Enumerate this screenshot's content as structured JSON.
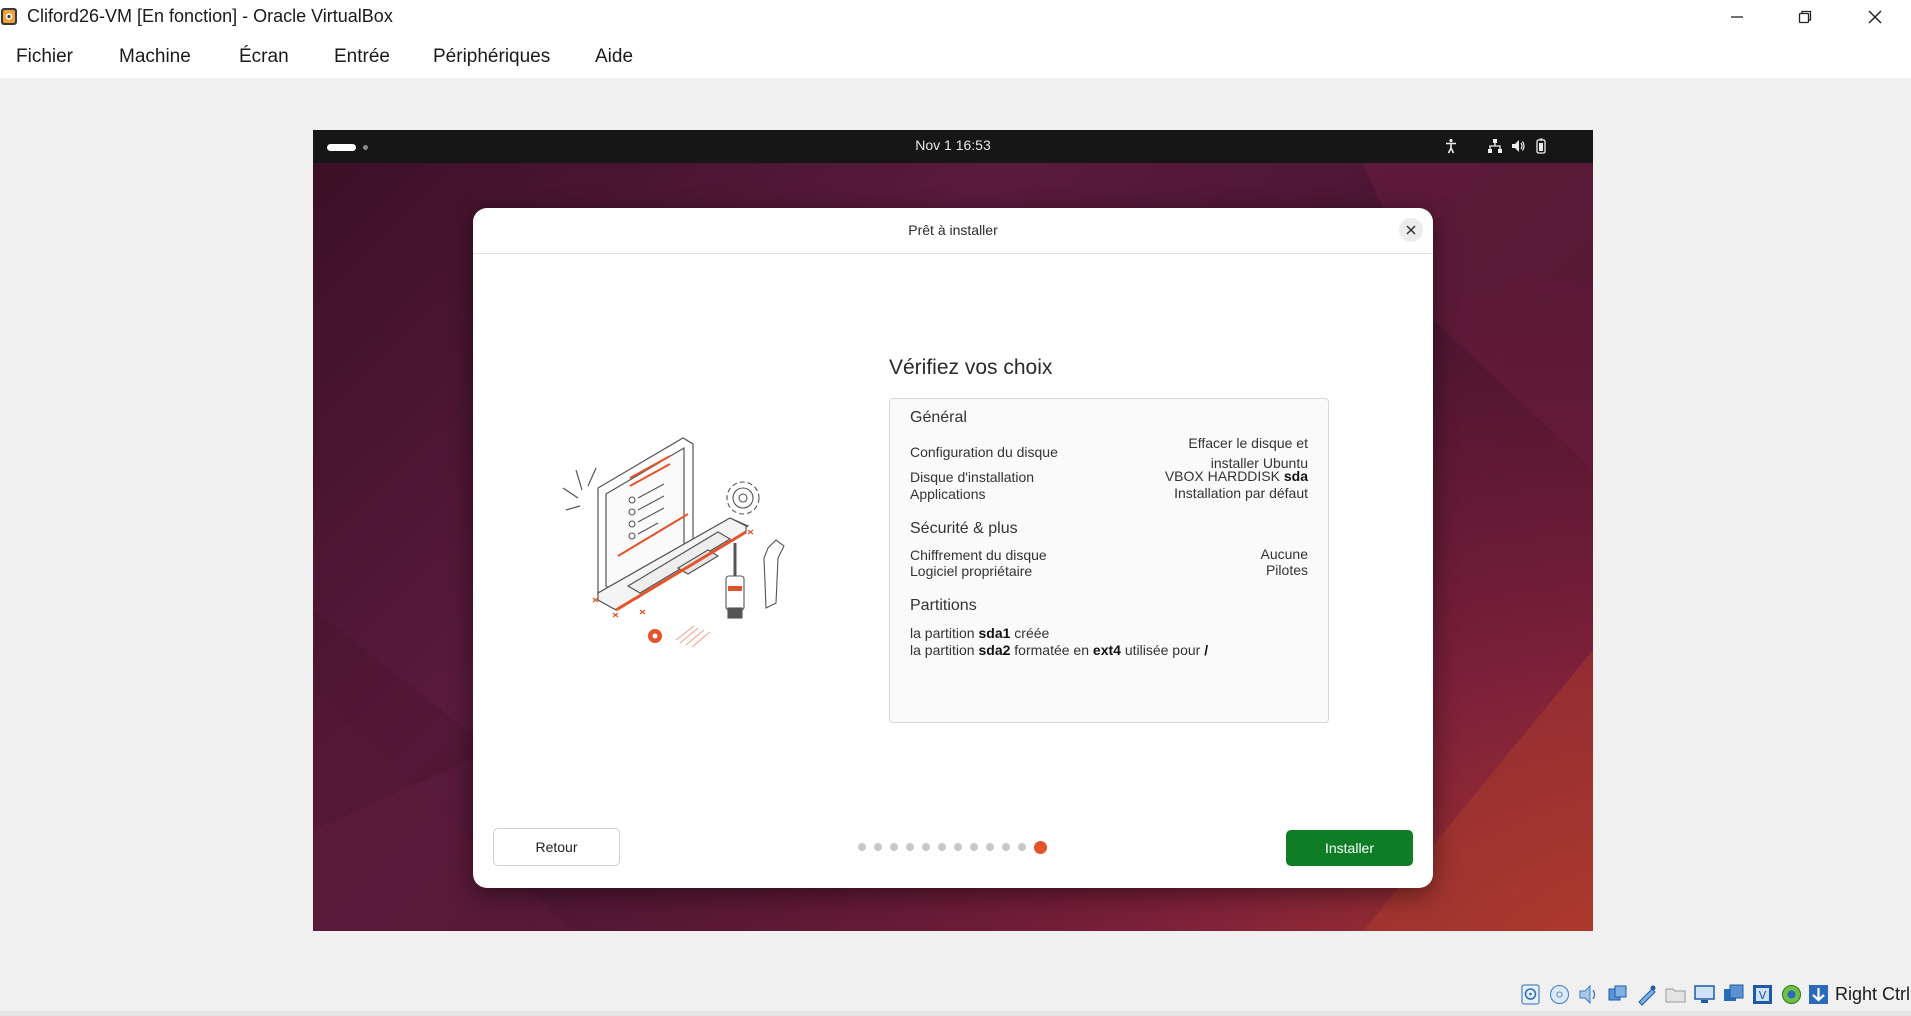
{
  "window": {
    "title": "Cliford26-VM [En fonction] - Oracle VirtualBox"
  },
  "menu": [
    "Fichier",
    "Machine",
    "Écran",
    "Entrée",
    "Périphériques",
    "Aide"
  ],
  "guest": {
    "topbar": {
      "clock": "Nov 1  16:53"
    },
    "dialog": {
      "title": "Prêt à installer",
      "heading": "Vérifiez vos choix",
      "general": {
        "title": "Général",
        "rows": [
          {
            "label": "Configuration du disque",
            "value_line1": "Effacer le disque et",
            "value_line2": "installer Ubuntu"
          },
          {
            "label": "Disque d'installation",
            "value_prefix": "VBOX HARDDISK",
            "value_bold": "sda"
          },
          {
            "label": "Applications",
            "value": "Installation par défaut"
          }
        ]
      },
      "security": {
        "title": "Sécurité & plus",
        "rows": [
          {
            "label": "Chiffrement du disque",
            "value": "Aucune"
          },
          {
            "label": "Logiciel propriétaire",
            "value": "Pilotes"
          }
        ]
      },
      "partitions": {
        "title": "Partitions",
        "line1": {
          "t1": "la partition",
          "b1": "sda1",
          "t2": "créée"
        },
        "line2": {
          "t1": "la partition",
          "b1": "sda2",
          "t2": "formatée en",
          "b2": "ext4",
          "t3": "utilisée pour",
          "b3": "/"
        }
      },
      "back_label": "Retour",
      "install_label": "Installer",
      "progress": {
        "step": 12,
        "total": 12
      }
    }
  },
  "statusbar": {
    "host_key": "Right Ctrl"
  },
  "colors": {
    "accent": "#e4532a",
    "install": "#0e7d26",
    "topbar": "#161616"
  }
}
